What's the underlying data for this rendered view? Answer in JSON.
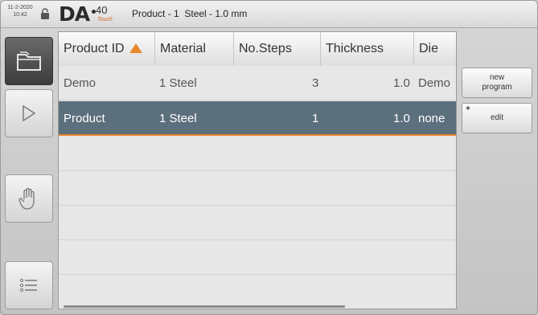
{
  "header": {
    "date": "11-2-2020",
    "time": "10:42",
    "logo_text": "DA",
    "logo_model": "40",
    "logo_sub": "Touch",
    "title": "Product - 1  Steel - 1.0 mm"
  },
  "nav": {
    "items": [
      {
        "name": "product-library",
        "icon": "folder-icon",
        "active": true
      },
      {
        "name": "automatic-mode",
        "icon": "play-icon",
        "active": false
      },
      {
        "name": "manual-mode",
        "icon": "hand-icon",
        "active": false
      },
      {
        "name": "settings-menu",
        "icon": "list-icon",
        "active": false
      }
    ]
  },
  "table": {
    "columns": [
      "Product ID",
      "Material",
      "No.Steps",
      "Thickness",
      "Die"
    ],
    "sort_column": "Product ID",
    "sort_direction": "ascending",
    "rows": [
      {
        "product_id": "Demo",
        "material": "1 Steel",
        "steps": "3",
        "thickness": "1.0",
        "die": "Demo"
      },
      {
        "product_id": "Product",
        "material": "1 Steel",
        "steps": "1",
        "thickness": "1.0",
        "die": "none"
      }
    ],
    "selected_row": 1
  },
  "actions": {
    "new_program": "new\nprogram",
    "edit": "edit",
    "edit_prefix": "+"
  },
  "colors": {
    "accent": "#e8862a",
    "selected_row": "#5c6f7d"
  }
}
